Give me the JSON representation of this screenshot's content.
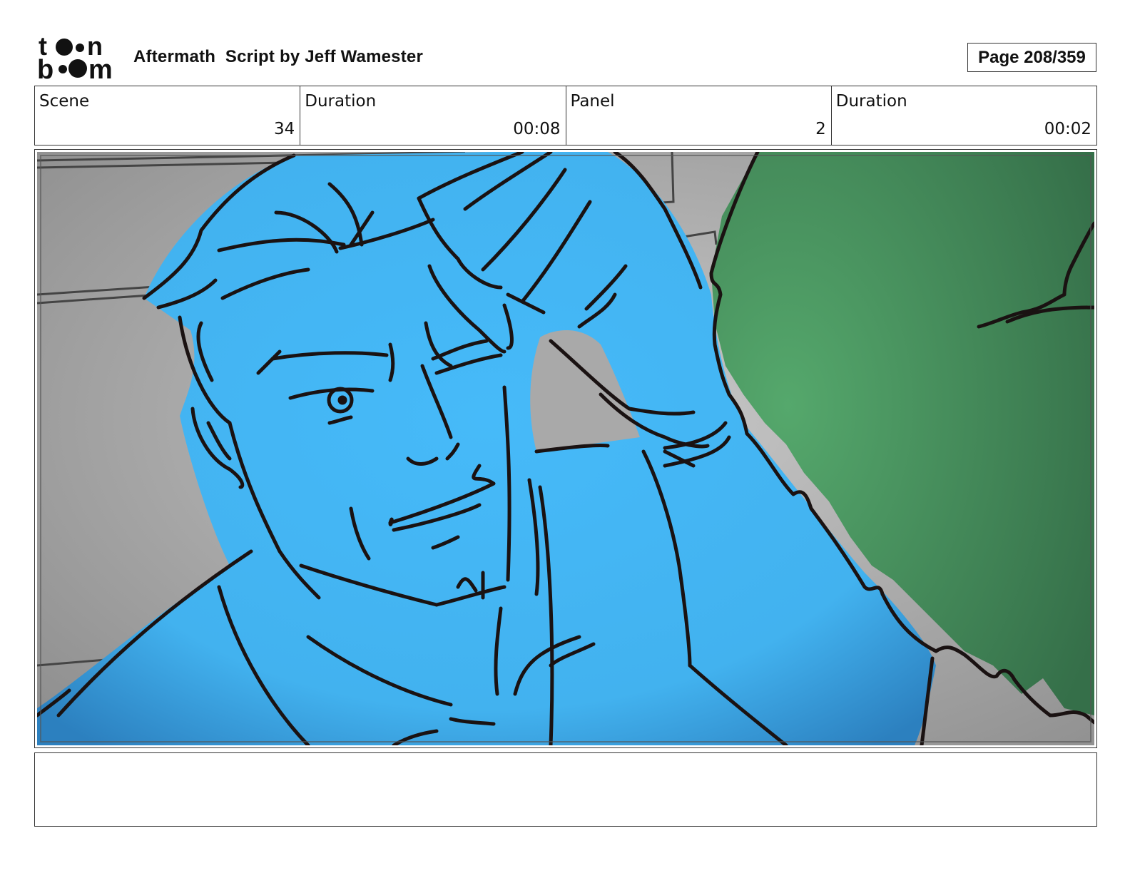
{
  "header": {
    "logo_text": "toon boom",
    "title": "Aftermath  Script by Jeff Wamester",
    "page": "Page 208/359"
  },
  "info": {
    "scene_label": "Scene",
    "scene_value": "34",
    "scene_duration_label": "Duration",
    "scene_duration_value": "00:08",
    "panel_label": "Panel",
    "panel_value": "2",
    "panel_duration_label": "Duration",
    "panel_duration_value": "00:02"
  },
  "caption": {
    "text": ""
  },
  "colors": {
    "figure_fill": "#45b8f8",
    "foreground_fill": "#4f9f68",
    "background_fill": "#a9a9a9",
    "line": "#1a1212"
  }
}
